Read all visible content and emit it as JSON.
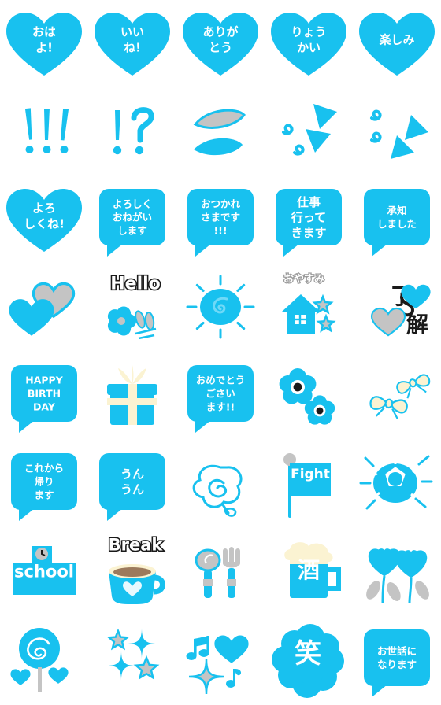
{
  "sheet": {
    "title": "Emoji sticker sheet",
    "columns": 5,
    "rows": 8,
    "cell_size": 112,
    "background": "#ffffff"
  },
  "colors": {
    "cyan": "#18c1ef",
    "cyan_light": "#6fd9f7",
    "white": "#ffffff",
    "grey": "#c4c4c4",
    "grey_dark": "#9a9a9a",
    "cream": "#fbf3d2",
    "black": "#1a1a1a",
    "brown": "#9c7a5c"
  },
  "emoji": [
    {
      "id": "ohayo-heart",
      "name": "heart-ohayo",
      "shape": "heart",
      "lines": [
        "おは",
        "よ!"
      ]
    },
    {
      "id": "iine-heart",
      "name": "heart-iine",
      "shape": "heart",
      "lines": [
        "いい",
        "ね!"
      ]
    },
    {
      "id": "arigatou-heart",
      "name": "heart-arigatou",
      "shape": "heart",
      "lines": [
        "ありが",
        "とう"
      ]
    },
    {
      "id": "ryoukai-heart",
      "name": "heart-ryoukai",
      "shape": "heart",
      "lines": [
        "りょう",
        "かい"
      ]
    },
    {
      "id": "tanoshimi-heart",
      "name": "heart-tanoshimi",
      "shape": "heart",
      "lines": [
        "楽しみ"
      ]
    },
    {
      "id": "exclamations",
      "name": "triple-exclamation-icon",
      "shape": "marks",
      "lines": [
        "!!!"
      ]
    },
    {
      "id": "interrobang",
      "name": "interrobang-icon",
      "shape": "marks",
      "lines": [
        "!?"
      ]
    },
    {
      "id": "leaves",
      "name": "two-leaves-icon",
      "shape": "leaves",
      "lines": []
    },
    {
      "id": "arrows-up",
      "name": "double-arrow-up-icon",
      "shape": "arrows-up",
      "lines": []
    },
    {
      "id": "arrows-down",
      "name": "double-arrow-down-icon",
      "shape": "arrows-down",
      "lines": []
    },
    {
      "id": "yoroshikune-heart",
      "name": "heart-yoroshikune",
      "shape": "heart",
      "lines": [
        "よろ",
        "しくね!"
      ]
    },
    {
      "id": "yoroshiku-bubble",
      "name": "bubble-yoroshiku-onegaishimasu",
      "shape": "bubble",
      "lines": [
        "よろしく",
        "おねがい",
        "します"
      ]
    },
    {
      "id": "otsukare-bubble",
      "name": "bubble-otsukaresama",
      "shape": "bubble",
      "lines": [
        "おつかれ",
        "さまです",
        "!!!"
      ]
    },
    {
      "id": "shigoto-bubble",
      "name": "bubble-shigoto-ittekimasu",
      "shape": "bubble",
      "lines": [
        "仕事",
        "行って",
        "きます"
      ]
    },
    {
      "id": "shouchi-bubble",
      "name": "bubble-shouchi-shimashita",
      "shape": "bubble",
      "lines": [
        "承知",
        "しました"
      ]
    },
    {
      "id": "two-hearts",
      "name": "two-hearts-icon",
      "shape": "two-hearts",
      "lines": []
    },
    {
      "id": "hello-flower",
      "name": "hello-flower-icon",
      "shape": "hello",
      "lines": [
        "Hello"
      ]
    },
    {
      "id": "sun",
      "name": "sun-icon",
      "shape": "sun",
      "lines": []
    },
    {
      "id": "oyasumi-house",
      "name": "oyasumi-house-icon",
      "shape": "house",
      "lines": [
        "おやすみ"
      ]
    },
    {
      "id": "ryoukai-hearts",
      "name": "ryoukai-hearts-icon",
      "shape": "ryoukai",
      "lines": [
        "了",
        "解"
      ]
    },
    {
      "id": "happy-birthday",
      "name": "bubble-happy-birthday",
      "shape": "bubble",
      "lines": [
        "HAPPY",
        "BIRTH",
        "DAY"
      ]
    },
    {
      "id": "gift",
      "name": "gift-box-icon",
      "shape": "gift",
      "lines": []
    },
    {
      "id": "omedetou-bubble",
      "name": "bubble-omedetou-gozaimasu",
      "shape": "bubble",
      "lines": [
        "おめでとう",
        "ごさい",
        "ます!!"
      ]
    },
    {
      "id": "flowers",
      "name": "two-flowers-icon",
      "shape": "flowers",
      "lines": []
    },
    {
      "id": "ribbons",
      "name": "two-ribbons-icon",
      "shape": "ribbons",
      "lines": []
    },
    {
      "id": "korekara-bubble",
      "name": "bubble-korekara-kaerimasu",
      "shape": "bubble",
      "lines": [
        "これから",
        "帰り",
        "ます"
      ]
    },
    {
      "id": "unun-bubble",
      "name": "bubble-unun",
      "shape": "bubble",
      "lines": [
        "うん",
        "うん"
      ]
    },
    {
      "id": "rose",
      "name": "rose-outline-icon",
      "shape": "rose",
      "lines": []
    },
    {
      "id": "fight-flag",
      "name": "fight-flag-icon",
      "shape": "flag",
      "lines": [
        "Fight"
      ]
    },
    {
      "id": "soccer-ball",
      "name": "soccer-ball-icon",
      "shape": "ball",
      "lines": []
    },
    {
      "id": "school",
      "name": "school-building-icon",
      "shape": "school",
      "lines": [
        "school"
      ]
    },
    {
      "id": "break-cup",
      "name": "break-coffee-icon",
      "shape": "cup",
      "lines": [
        "Break"
      ]
    },
    {
      "id": "cutlery",
      "name": "spoon-fork-icon",
      "shape": "cutlery",
      "lines": []
    },
    {
      "id": "beer-sake",
      "name": "beer-mug-sake-icon",
      "shape": "beer",
      "lines": [
        "酒"
      ]
    },
    {
      "id": "tulips",
      "name": "two-tulips-icon",
      "shape": "tulips",
      "lines": []
    },
    {
      "id": "lollipop",
      "name": "lollipop-icon",
      "shape": "lollipop",
      "lines": []
    },
    {
      "id": "sparkle-stars",
      "name": "sparkle-stars-icon",
      "shape": "stars",
      "lines": []
    },
    {
      "id": "music-heart",
      "name": "music-note-heart-icon",
      "shape": "music",
      "lines": []
    },
    {
      "id": "warau-cloud",
      "name": "cloud-warau",
      "shape": "cloud",
      "lines": [
        "笑"
      ]
    },
    {
      "id": "osewa-bubble",
      "name": "bubble-osewa-ni-narimasu",
      "shape": "bubble",
      "lines": [
        "お世話に",
        "なります"
      ]
    }
  ]
}
